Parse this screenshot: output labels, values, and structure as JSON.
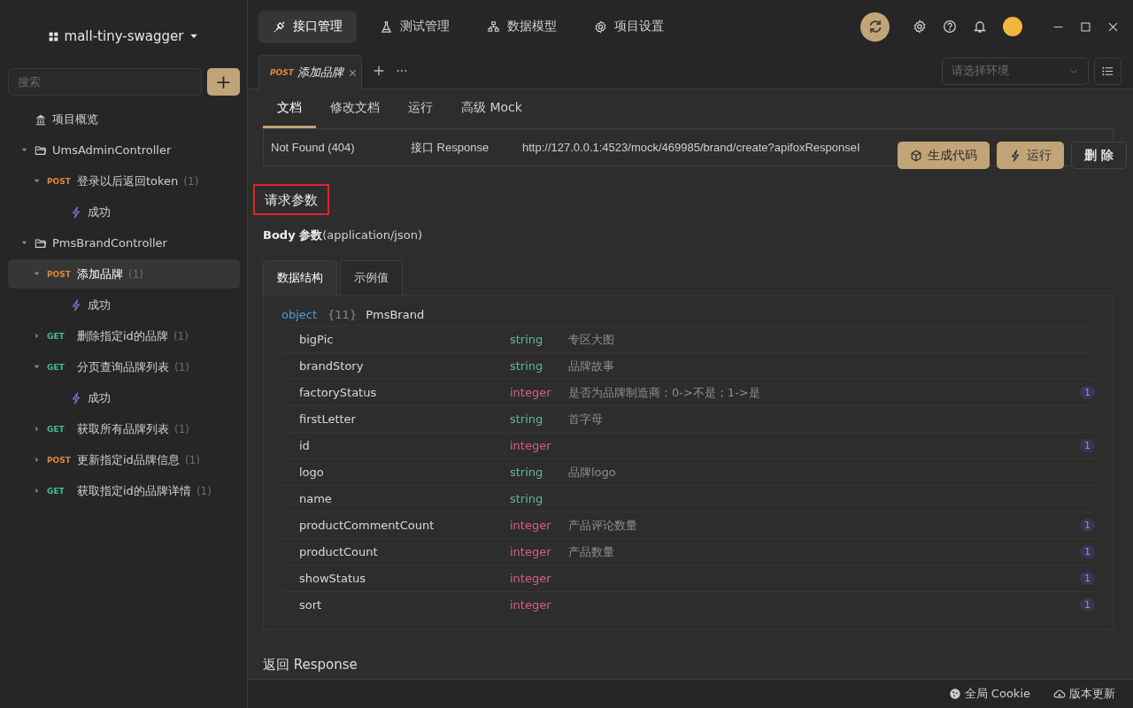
{
  "project": {
    "name": "mall-tiny-swagger"
  },
  "sidebar": {
    "search": {
      "placeholder": "搜索"
    },
    "add_button": "+",
    "tree": [
      {
        "kind": "overview",
        "label": "项目概览",
        "selected": false
      },
      {
        "kind": "folder",
        "label": "UmsAdminController",
        "expanded": true,
        "selected": false,
        "children": [
          {
            "kind": "api",
            "method": "POST",
            "label": "登录以后返回token",
            "count": "(1)",
            "expanded": true,
            "selected": false,
            "children": [
              {
                "kind": "case",
                "label": "成功",
                "selected": false
              }
            ]
          }
        ]
      },
      {
        "kind": "folder",
        "label": "PmsBrandController",
        "expanded": true,
        "selected": false,
        "children": [
          {
            "kind": "api",
            "method": "POST",
            "label": "添加品牌",
            "count": "(1)",
            "expanded": true,
            "selected": true,
            "children": [
              {
                "kind": "case",
                "label": "成功",
                "selected": false
              }
            ]
          },
          {
            "kind": "api",
            "method": "GET",
            "label": "删除指定id的品牌",
            "count": "(1)",
            "expanded": false,
            "selected": false
          },
          {
            "kind": "api",
            "method": "GET",
            "label": "分页查询品牌列表",
            "count": "(1)",
            "expanded": true,
            "selected": false,
            "children": [
              {
                "kind": "case",
                "label": "成功",
                "selected": false
              }
            ]
          },
          {
            "kind": "api",
            "method": "GET",
            "label": "获取所有品牌列表",
            "count": "(1)",
            "expanded": false,
            "selected": false
          },
          {
            "kind": "api",
            "method": "POST",
            "label": "更新指定id品牌信息",
            "count": "(1)",
            "expanded": false,
            "selected": false
          },
          {
            "kind": "api",
            "method": "GET",
            "label": "获取指定id的品牌详情",
            "count": "(1)",
            "expanded": false,
            "selected": false
          }
        ]
      }
    ]
  },
  "top_nav": [
    {
      "label": "接口管理",
      "selected": true
    },
    {
      "label": "测试管理",
      "selected": false
    },
    {
      "label": "数据模型",
      "selected": false
    },
    {
      "label": "项目设置",
      "selected": false
    }
  ],
  "open_tabs": [
    {
      "method": "POST",
      "label": "添加品牌",
      "selected": true
    }
  ],
  "environment": {
    "placeholder": "请选择环境"
  },
  "doc_tabs": [
    {
      "label": "文档",
      "selected": true
    },
    {
      "label": "修改文档",
      "selected": false
    },
    {
      "label": "运行",
      "selected": false
    },
    {
      "label": "高级 Mock",
      "selected": false
    }
  ],
  "mock_row": {
    "status": "Not Found (404)",
    "name": "接口 Response",
    "url": "http://127.0.0.1:4523/mock/469985/brand/create?apifoxResponseI"
  },
  "actions": [
    {
      "kind": "code",
      "label": "生成代码"
    },
    {
      "kind": "run",
      "label": "运行"
    },
    {
      "kind": "delete",
      "label": "删 除"
    }
  ],
  "request": {
    "title": "请求参数",
    "body_label": "**Body 参数**(application/json)",
    "tabs": [
      {
        "label": "数据结构",
        "selected": true
      },
      {
        "label": "示例值",
        "selected": false
      }
    ],
    "schema": {
      "type": "object",
      "count": "{11}",
      "name": "PmsBrand",
      "fields": [
        {
          "name": "bigPic",
          "type": "string",
          "description": "专区大图"
        },
        {
          "name": "brandStory",
          "type": "string",
          "description": "品牌故事"
        },
        {
          "name": "factoryStatus",
          "type": "integer",
          "description": "是否为品牌制造商：0->不是；1->是",
          "badge": "1"
        },
        {
          "name": "firstLetter",
          "type": "string",
          "description": "首字母"
        },
        {
          "name": "id",
          "type": "integer",
          "badge": "1"
        },
        {
          "name": "logo",
          "type": "string",
          "description": "品牌logo"
        },
        {
          "name": "name",
          "type": "string"
        },
        {
          "name": "productCommentCount",
          "type": "integer",
          "description": "产品评论数量",
          "badge": "1"
        },
        {
          "name": "productCount",
          "type": "integer",
          "description": "产品数量",
          "badge": "1"
        },
        {
          "name": "showStatus",
          "type": "integer",
          "badge": "1"
        },
        {
          "name": "sort",
          "type": "integer",
          "badge": "1"
        }
      ]
    }
  },
  "response": {
    "title": "返回 Response"
  },
  "status_bar": [
    {
      "label": "全局 Cookie"
    },
    {
      "label": "版本更新"
    }
  ]
}
